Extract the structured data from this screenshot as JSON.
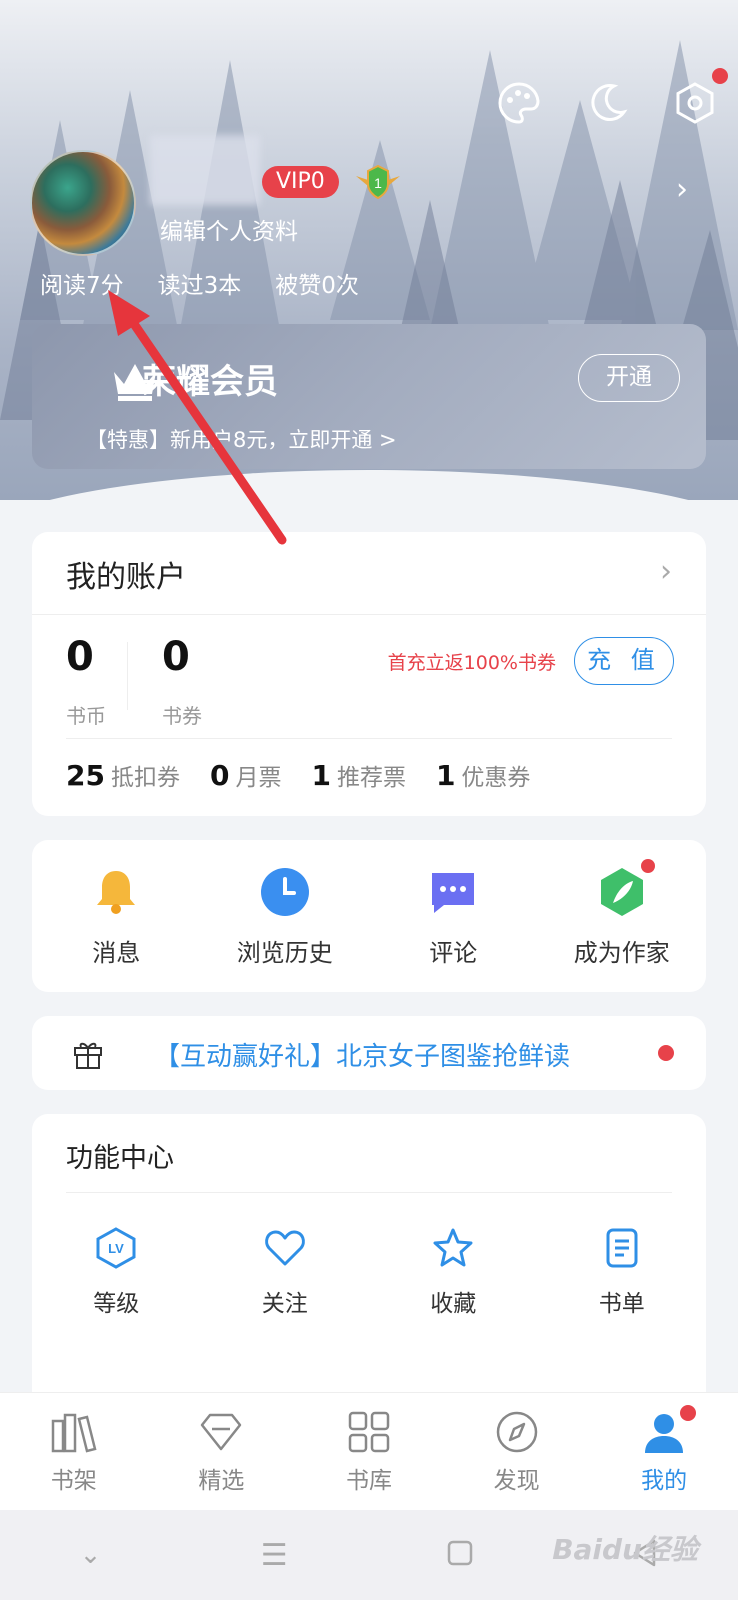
{
  "profile": {
    "vip_label": "VIP0",
    "level_badge": "1",
    "edit_profile": "编辑个人资料",
    "stats": [
      "阅读7分",
      "读过3本",
      "被赞0次"
    ]
  },
  "vip_card": {
    "title": "荣耀会员",
    "subtitle": "【特惠】新用户8元，立即开通 >",
    "open_button": "开通"
  },
  "account": {
    "title": "我的账户",
    "coins_value": "0",
    "coins_label": "书币",
    "vouchers_value": "0",
    "vouchers_label": "书券",
    "promo": "首充立返100%书券",
    "recharge_button": "充 值",
    "coupons": [
      {
        "value": "25",
        "label": "抵扣券"
      },
      {
        "value": "0",
        "label": "月票"
      },
      {
        "value": "1",
        "label": "推荐票"
      },
      {
        "value": "1",
        "label": "优惠券"
      }
    ]
  },
  "quick_actions": [
    {
      "label": "消息",
      "icon": "bell-icon",
      "color": "#f5b73b"
    },
    {
      "label": "浏览历史",
      "icon": "clock-icon",
      "color": "#3a8ff0"
    },
    {
      "label": "评论",
      "icon": "chat-bubble-icon",
      "color": "#6b6ff2"
    },
    {
      "label": "成为作家",
      "icon": "feather-icon",
      "color": "#3fbf6a"
    }
  ],
  "banner": {
    "text": "【互动赢好礼】北京女子图鉴抢鲜读"
  },
  "function_center": {
    "title": "功能中心",
    "items": [
      {
        "label": "等级",
        "icon": "level-icon"
      },
      {
        "label": "关注",
        "icon": "heart-icon"
      },
      {
        "label": "收藏",
        "icon": "star-icon"
      },
      {
        "label": "书单",
        "icon": "booklist-icon"
      }
    ]
  },
  "tabs": [
    {
      "label": "书架",
      "icon": "bookshelf-icon"
    },
    {
      "label": "精选",
      "icon": "diamond-icon"
    },
    {
      "label": "书库",
      "icon": "grid-icon"
    },
    {
      "label": "发现",
      "icon": "compass-icon"
    },
    {
      "label": "我的",
      "icon": "user-icon"
    }
  ],
  "watermark": "Baidu经验",
  "colors": {
    "accent": "#2f8fe6",
    "red": "#e7424a"
  }
}
